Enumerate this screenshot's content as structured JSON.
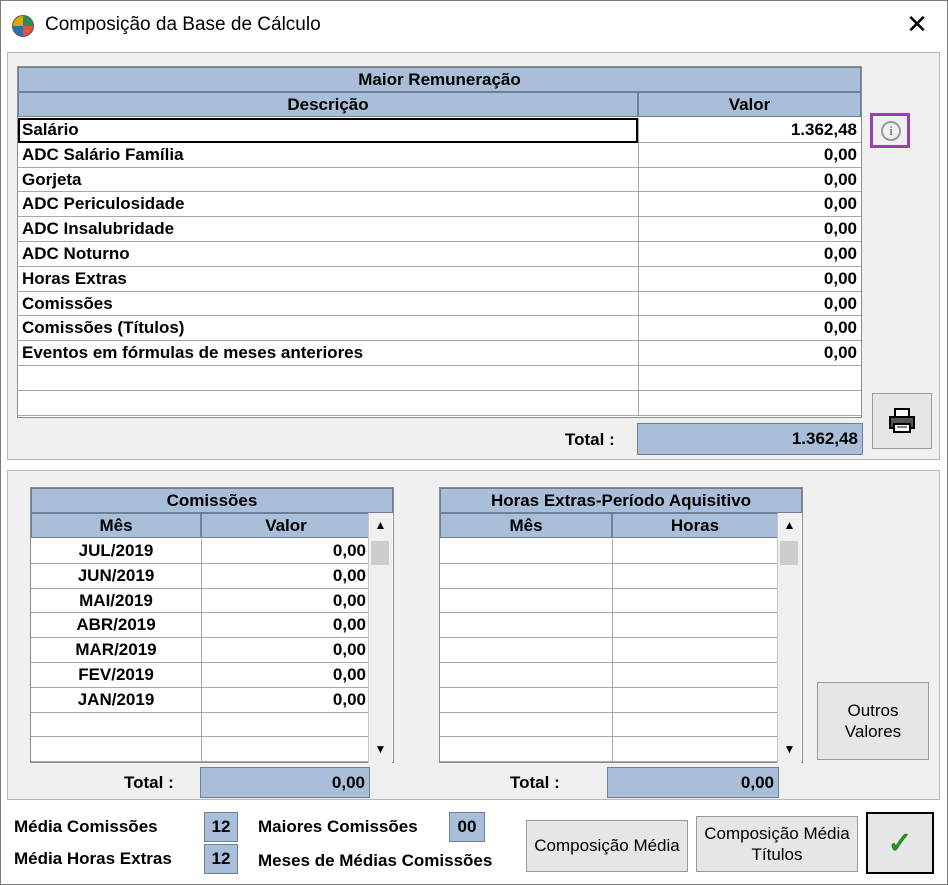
{
  "window": {
    "title": "Composição da Base de Cálculo",
    "close_symbol": "✕",
    "app_icon": "app-icon"
  },
  "main_grid": {
    "title": "Maior Remuneração",
    "col_desc": "Descrição",
    "col_valor": "Valor",
    "rows": [
      {
        "desc": "Salário",
        "valor": "1.362,48"
      },
      {
        "desc": "ADC Salário Família",
        "valor": "0,00"
      },
      {
        "desc": "Gorjeta",
        "valor": "0,00"
      },
      {
        "desc": "ADC Periculosidade",
        "valor": "0,00"
      },
      {
        "desc": "ADC Insalubridade",
        "valor": "0,00"
      },
      {
        "desc": "ADC Noturno",
        "valor": "0,00"
      },
      {
        "desc": "Horas Extras",
        "valor": "0,00"
      },
      {
        "desc": "Comissões",
        "valor": "0,00"
      },
      {
        "desc": "Comissões (Títulos)",
        "valor": "0,00"
      },
      {
        "desc": "Eventos em fórmulas de meses anteriores",
        "valor": "0,00"
      }
    ],
    "total_label": "Total :",
    "total_value": "1.362,48"
  },
  "comissoes_grid": {
    "title": "Comissões",
    "col_mes": "Mês",
    "col_valor": "Valor",
    "rows": [
      {
        "mes": "JUL/2019",
        "valor": "0,00"
      },
      {
        "mes": "JUN/2019",
        "valor": "0,00"
      },
      {
        "mes": "MAI/2019",
        "valor": "0,00"
      },
      {
        "mes": "ABR/2019",
        "valor": "0,00"
      },
      {
        "mes": "MAR/2019",
        "valor": "0,00"
      },
      {
        "mes": "FEV/2019",
        "valor": "0,00"
      },
      {
        "mes": "JAN/2019",
        "valor": "0,00"
      }
    ],
    "total_label": "Total :",
    "total_value": "0,00"
  },
  "horas_grid": {
    "title": "Horas Extras-Período Aquisitivo",
    "col_mes": "Mês",
    "col_horas": "Horas",
    "total_label": "Total :",
    "total_value": "0,00"
  },
  "buttons": {
    "outros_valores": "Outros Valores",
    "composicao_media": "Composição Média",
    "composicao_media_titulos": "Composição Média Títulos",
    "ok_symbol": "✓"
  },
  "bottom": {
    "media_comissoes_label": "Média Comissões",
    "media_comissoes_value": "12",
    "media_horas_label": "Média Horas Extras",
    "media_horas_value": "12",
    "maiores_comissoes_label": "Maiores Comissões",
    "maiores_comissoes_value": "00",
    "meses_label": "Meses de Médias Comissões"
  },
  "scroll": {
    "up": "▲",
    "down": "▼"
  },
  "colors": {
    "header": "#a9bfd9",
    "info_highlight": "#9b3fb5",
    "ok_check": "#2e8b2e"
  }
}
